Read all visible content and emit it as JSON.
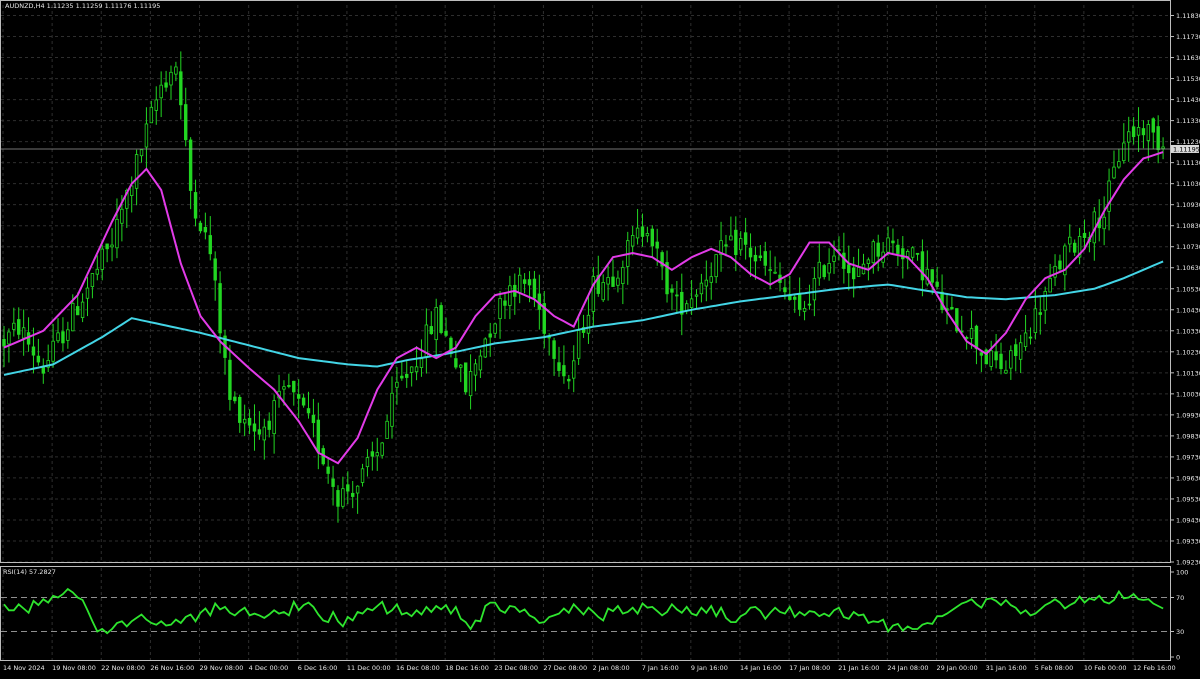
{
  "main_window": {
    "info": "AUDNZD,H4  1.11235 1.11259 1.11176 1.11195",
    "current_price": "1.11195"
  },
  "rsi_window": {
    "info": "RSI(14) 57.2827"
  },
  "colors": {
    "background": "#000000",
    "grid": "#2e2e2e",
    "candles": "#22d622",
    "ma_fast": "#e23be8",
    "ma_slow": "#43d5e6",
    "rsi_line": "#2ee52e",
    "text": "#e8e8e8"
  },
  "chart_data": [
    {
      "type": "candlestick",
      "symbol": "AUDNZD",
      "timeframe": "H4",
      "ylim": [
        1.0923,
        1.1188
      ],
      "price_ticks": [
        "1.11830",
        "1.11730",
        "1.11630",
        "1.11530",
        "1.11430",
        "1.11330",
        "1.11230",
        "1.11130",
        "1.11030",
        "1.10930",
        "1.10830",
        "1.10730",
        "1.10630",
        "1.10530",
        "1.10430",
        "1.10330",
        "1.10230",
        "1.10130",
        "1.10030",
        "1.09930",
        "1.09830",
        "1.09730",
        "1.09630",
        "1.09530",
        "1.09430",
        "1.09330",
        "1.09230"
      ],
      "time_labels": [
        "14 Nov 2024",
        "19 Nov 08:00",
        "22 Nov 08:00",
        "26 Nov 16:00",
        "29 Nov 08:00",
        "4 Dec 00:00",
        "6 Dec 16:00",
        "11 Dec 00:00",
        "16 Dec 08:00",
        "18 Dec 16:00",
        "23 Dec 08:00",
        "27 Dec 08:00",
        "2 Jan 08:00",
        "7 Jan 16:00",
        "9 Jan 16:00",
        "14 Jan 16:00",
        "17 Jan 08:00",
        "21 Jan 16:00",
        "24 Jan 08:00",
        "29 Jan 00:00",
        "31 Jan 16:00",
        "5 Feb 08:00",
        "10 Feb 00:00",
        "12 Feb 16:00"
      ],
      "price_path": [
        [
          0,
          1.1028
        ],
        [
          3,
          1.1035
        ],
        [
          8,
          1.1015
        ],
        [
          15,
          1.1045
        ],
        [
          22,
          1.1075
        ],
        [
          28,
          1.112
        ],
        [
          32,
          1.115
        ],
        [
          35,
          1.116
        ],
        [
          38,
          1.11
        ],
        [
          42,
          1.107
        ],
        [
          46,
          1.1
        ],
        [
          52,
          1.0985
        ],
        [
          58,
          1.1005
        ],
        [
          63,
          1.0985
        ],
        [
          68,
          1.0955
        ],
        [
          72,
          1.096
        ],
        [
          76,
          1.0975
        ],
        [
          80,
          1.1005
        ],
        [
          84,
          1.102
        ],
        [
          88,
          1.104
        ],
        [
          91,
          1.1025
        ],
        [
          94,
          1.1005
        ],
        [
          98,
          1.103
        ],
        [
          103,
          1.1055
        ],
        [
          107,
          1.1055
        ],
        [
          111,
          1.103
        ],
        [
          115,
          1.101
        ],
        [
          120,
          1.1055
        ],
        [
          124,
          1.106
        ],
        [
          128,
          1.1075
        ],
        [
          131,
          1.1085
        ],
        [
          134,
          1.106
        ],
        [
          137,
          1.1045
        ],
        [
          140,
          1.105
        ],
        [
          143,
          1.106
        ],
        [
          146,
          1.107
        ],
        [
          150,
          1.1075
        ],
        [
          154,
          1.1065
        ],
        [
          158,
          1.1055
        ],
        [
          162,
          1.104
        ],
        [
          166,
          1.106
        ],
        [
          170,
          1.1075
        ],
        [
          173,
          1.1055
        ],
        [
          176,
          1.107
        ],
        [
          180,
          1.1075
        ],
        [
          184,
          1.107
        ],
        [
          188,
          1.106
        ],
        [
          192,
          1.104
        ],
        [
          196,
          1.1035
        ],
        [
          200,
          1.102
        ],
        [
          204,
          1.1015
        ],
        [
          208,
          1.103
        ],
        [
          212,
          1.105
        ],
        [
          216,
          1.107
        ],
        [
          220,
          1.108
        ],
        [
          224,
          1.109
        ],
        [
          228,
          1.1125
        ],
        [
          232,
          1.113
        ],
        [
          236,
          1.1122
        ]
      ],
      "series": [
        {
          "name": "AUDNZD,H4"
        },
        {
          "path": [
            [
              0,
              1.1025
            ],
            [
              8,
              1.1033
            ],
            [
              15,
              1.105
            ],
            [
              22,
              1.1085
            ],
            [
              26,
              1.1103
            ],
            [
              29,
              1.111
            ],
            [
              32,
              1.11
            ],
            [
              36,
              1.1065
            ],
            [
              40,
              1.104
            ],
            [
              44,
              1.1028
            ],
            [
              50,
              1.1015
            ],
            [
              55,
              1.1005
            ],
            [
              60,
              1.099
            ],
            [
              64,
              1.0975
            ],
            [
              68,
              1.097
            ],
            [
              72,
              1.0982
            ],
            [
              76,
              1.1005
            ],
            [
              80,
              1.102
            ],
            [
              84,
              1.1025
            ],
            [
              88,
              1.102
            ],
            [
              92,
              1.1025
            ],
            [
              96,
              1.104
            ],
            [
              100,
              1.105
            ],
            [
              104,
              1.1052
            ],
            [
              108,
              1.1048
            ],
            [
              112,
              1.104
            ],
            [
              116,
              1.1035
            ],
            [
              120,
              1.1055
            ],
            [
              124,
              1.1068
            ],
            [
              128,
              1.107
            ],
            [
              132,
              1.1068
            ],
            [
              136,
              1.1062
            ],
            [
              140,
              1.1068
            ],
            [
              144,
              1.1072
            ],
            [
              148,
              1.1068
            ],
            [
              152,
              1.106
            ],
            [
              156,
              1.1055
            ],
            [
              160,
              1.106
            ],
            [
              164,
              1.1075
            ],
            [
              168,
              1.1075
            ],
            [
              172,
              1.1065
            ],
            [
              176,
              1.1062
            ],
            [
              180,
              1.107
            ],
            [
              184,
              1.1068
            ],
            [
              188,
              1.1058
            ],
            [
              192,
              1.1042
            ],
            [
              196,
              1.1028
            ],
            [
              200,
              1.1022
            ],
            [
              204,
              1.1032
            ],
            [
              208,
              1.1048
            ],
            [
              212,
              1.1058
            ],
            [
              216,
              1.1062
            ],
            [
              220,
              1.1072
            ],
            [
              224,
              1.109
            ],
            [
              228,
              1.1105
            ],
            [
              232,
              1.1115
            ],
            [
              236,
              1.1118
            ]
          ]
        },
        {
          "path": [
            [
              0,
              1.1012
            ],
            [
              10,
              1.1017
            ],
            [
              20,
              1.103
            ],
            [
              26,
              1.1039
            ],
            [
              32,
              1.1036
            ],
            [
              40,
              1.1032
            ],
            [
              50,
              1.1026
            ],
            [
              60,
              1.102
            ],
            [
              70,
              1.1017
            ],
            [
              76,
              1.1016
            ],
            [
              82,
              1.1019
            ],
            [
              90,
              1.1022
            ],
            [
              100,
              1.1027
            ],
            [
              110,
              1.103
            ],
            [
              120,
              1.1035
            ],
            [
              130,
              1.1038
            ],
            [
              140,
              1.1043
            ],
            [
              150,
              1.1047
            ],
            [
              160,
              1.105
            ],
            [
              170,
              1.1053
            ],
            [
              180,
              1.1055
            ],
            [
              188,
              1.1052
            ],
            [
              196,
              1.1049
            ],
            [
              204,
              1.1048
            ],
            [
              214,
              1.105
            ],
            [
              222,
              1.1053
            ],
            [
              228,
              1.1058
            ],
            [
              236,
              1.1066
            ]
          ]
        }
      ]
    },
    {
      "type": "line",
      "title": "RSI(14) 57.2827",
      "ylim": [
        0,
        100
      ],
      "levels": [
        30,
        70
      ],
      "ticks": [
        "100",
        "70",
        "30",
        "0"
      ],
      "series": [
        {
          "name": "RSI(14)",
          "values": [
            62,
            55,
            55,
            62,
            57,
            52,
            66,
            61,
            68,
            64,
            72,
            70,
            74,
            80,
            76,
            70,
            67,
            55,
            42,
            30,
            33,
            28,
            33,
            40,
            42,
            36,
            42,
            46,
            50,
            44,
            40,
            38,
            42,
            37,
            38,
            44,
            40,
            47,
            50,
            42,
            52,
            57,
            49,
            63,
            56,
            59,
            52,
            49,
            54,
            58,
            49,
            51,
            49,
            46,
            50,
            55,
            51,
            53,
            49,
            65,
            55,
            61,
            64,
            59,
            50,
            43,
            41,
            53,
            42,
            36,
            47,
            43,
            53,
            51,
            57,
            55,
            60,
            65,
            51,
            55,
            62,
            50,
            52,
            48,
            55,
            50,
            59,
            53,
            60,
            56,
            61,
            51,
            59,
            45,
            41,
            33,
            43,
            42,
            60,
            64,
            64,
            55,
            52,
            60,
            59,
            53,
            56,
            49,
            46,
            40,
            41,
            47,
            49,
            51,
            57,
            52,
            62,
            56,
            50,
            58,
            53,
            47,
            43,
            57,
            54,
            60,
            51,
            53,
            58,
            51,
            63,
            58,
            59,
            54,
            49,
            53,
            62,
            56,
            52,
            59,
            51,
            49,
            58,
            52,
            60,
            48,
            58,
            46,
            41,
            41,
            48,
            51,
            58,
            59,
            54,
            45,
            52,
            58,
            53,
            51,
            59,
            47,
            53,
            49,
            54,
            53,
            48,
            51,
            48,
            55,
            58,
            47,
            45,
            53,
            49,
            50,
            40,
            42,
            41,
            44,
            30,
            37,
            39,
            31,
            36,
            33,
            33,
            38,
            40,
            39,
            48,
            48,
            51,
            55,
            59,
            63,
            65,
            68,
            62,
            58,
            68,
            69,
            66,
            61,
            67,
            61,
            58,
            51,
            55,
            49,
            51,
            56,
            61,
            64,
            68,
            64,
            57,
            61,
            64,
            71,
            64,
            69,
            67,
            72,
            65,
            63,
            67,
            77,
            69,
            70,
            74,
            68,
            67,
            68,
            63,
            60,
            57
          ]
        }
      ]
    }
  ]
}
